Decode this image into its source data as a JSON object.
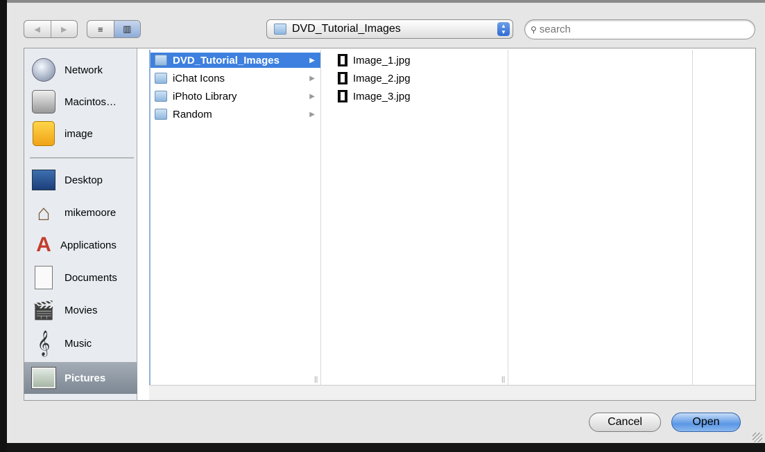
{
  "toolbar": {
    "back_icon": "◀",
    "forward_icon": "▶",
    "list_view_icon": "≡",
    "column_view_icon": "▥",
    "path_popup_label": "DVD_Tutorial_Images",
    "popup_arrows": "▲\n▼",
    "search_placeholder": "search",
    "search_glyph": "🔍"
  },
  "sidebar": {
    "devices": [
      {
        "label": "Network",
        "icon": "network-globe-icon"
      },
      {
        "label": "Macintos…",
        "icon": "hard-drive-icon"
      },
      {
        "label": "image",
        "icon": "ipod-icon"
      }
    ],
    "places": [
      {
        "label": "Desktop",
        "icon": "desktop-icon"
      },
      {
        "label": "mikemoore",
        "icon": "home-icon"
      },
      {
        "label": "Applications",
        "icon": "applications-icon"
      },
      {
        "label": "Documents",
        "icon": "documents-icon"
      },
      {
        "label": "Movies",
        "icon": "movies-icon"
      },
      {
        "label": "Music",
        "icon": "music-icon"
      },
      {
        "label": "Pictures",
        "icon": "pictures-icon",
        "selected": true
      }
    ]
  },
  "columns": {
    "col1": [
      {
        "label": "DVD_Tutorial_Images",
        "selected": true
      },
      {
        "label": "iChat Icons"
      },
      {
        "label": "iPhoto Library"
      },
      {
        "label": "Random"
      }
    ],
    "col2": [
      {
        "label": "Image_1.jpg"
      },
      {
        "label": "Image_2.jpg"
      },
      {
        "label": "Image_3.jpg"
      }
    ]
  },
  "buttons": {
    "cancel": "Cancel",
    "open": "Open"
  },
  "glyphs": {
    "arrow": "▶",
    "grip": "||",
    "home": "⌂",
    "applications": "A",
    "movies": "🎬",
    "music": "𝄞"
  }
}
